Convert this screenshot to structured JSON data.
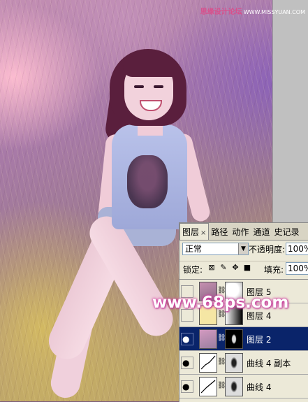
{
  "header": {
    "site_name": "思缘设计论坛",
    "site_url": "WWW.MISSYUAN.COM"
  },
  "watermark": {
    "text": "www.68ps.com"
  },
  "layers_panel": {
    "tabs": [
      {
        "label": "图层",
        "close": "×"
      },
      {
        "label": "路径"
      },
      {
        "label": "动作"
      },
      {
        "label": "通道"
      },
      {
        "label": "史记录"
      }
    ],
    "blend_mode": "正常",
    "opacity_label": "不透明度:",
    "opacity_value": "100%",
    "lock_label": "锁定:",
    "fill_label": "填充:",
    "fill_value": "100%",
    "layers": [
      {
        "name": "图层 5",
        "visible": false,
        "selected": false
      },
      {
        "name": "图层 4",
        "visible": false,
        "selected": false
      },
      {
        "name": "图层 2",
        "visible": true,
        "selected": true
      },
      {
        "name": "曲线 4 副本",
        "visible": true,
        "selected": false
      },
      {
        "name": "曲线 4",
        "visible": true,
        "selected": false
      }
    ]
  },
  "colors": {
    "selected_layer": "#0a246a",
    "panel_bg": "#ece9d8",
    "watermark_glow": "#d040a0",
    "header_text": "#d8508c"
  }
}
